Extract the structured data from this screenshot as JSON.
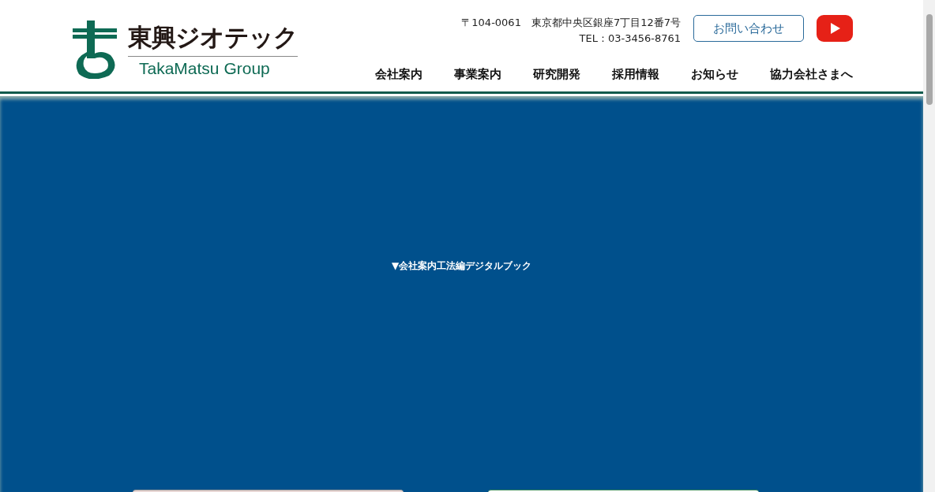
{
  "logo": {
    "name": "東興ジオテック",
    "group": "TakaMatsu Group"
  },
  "address": "〒104-0061　東京都中央区銀座7丁目12番7号",
  "phone": "TEL：03-3456-8761",
  "contact_button": "お問い合わせ",
  "nav": [
    {
      "label": "会社案内"
    },
    {
      "label": "事業案内"
    },
    {
      "label": "研究開発"
    },
    {
      "label": "採用情報"
    },
    {
      "label": "お知らせ"
    },
    {
      "label": "協力会社さまへ"
    }
  ],
  "hero": {
    "link": "▼会社案内工法編デジタルブック"
  }
}
